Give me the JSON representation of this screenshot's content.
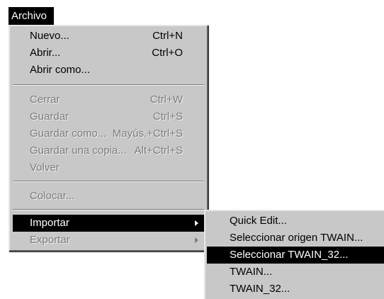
{
  "menubar": {
    "archivo_label": "Archivo"
  },
  "file_menu": {
    "nuevo": {
      "label": "Nuevo...",
      "shortcut": "Ctrl+N"
    },
    "abrir": {
      "label": "Abrir...",
      "shortcut": "Ctrl+O"
    },
    "abrir_como": {
      "label": "Abrir como..."
    },
    "cerrar": {
      "label": "Cerrar",
      "shortcut": "Ctrl+W"
    },
    "guardar": {
      "label": "Guardar",
      "shortcut": "Ctrl+S"
    },
    "guardar_como": {
      "label": "Guardar como...",
      "shortcut": "Mayús.+Ctrl+S"
    },
    "guardar_copia": {
      "label": "Guardar una copia...",
      "shortcut": "Alt+Ctrl+S"
    },
    "volver": {
      "label": "Volver"
    },
    "colocar": {
      "label": "Colocar..."
    },
    "importar": {
      "label": "Importar"
    },
    "exportar": {
      "label": "Exportar"
    }
  },
  "import_submenu": {
    "items": [
      "Quick Edit...",
      "Seleccionar origen TWAIN...",
      "Seleccionar TWAIN_32...",
      "TWAIN...",
      "TWAIN_32..."
    ]
  }
}
